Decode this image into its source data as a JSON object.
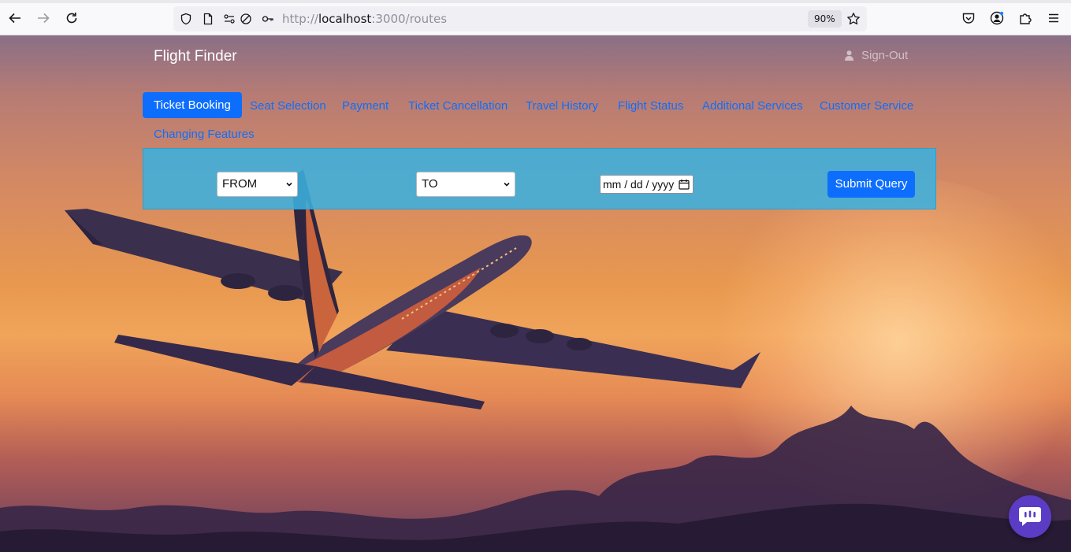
{
  "browser": {
    "url_scheme": "http://",
    "url_host": "localhost",
    "url_path": ":3000/routes",
    "zoom": "90%"
  },
  "header": {
    "brand": "Flight Finder",
    "signout_label": "Sign-Out"
  },
  "nav": {
    "items": [
      {
        "label": "Ticket Booking",
        "active": true
      },
      {
        "label": "Seat Selection"
      },
      {
        "label": "Payment"
      },
      {
        "label": "Ticket Cancellation"
      },
      {
        "label": "Travel History"
      },
      {
        "label": "Flight Status"
      },
      {
        "label": "Additional Services"
      },
      {
        "label": "Customer Service"
      },
      {
        "label": "Changing Features"
      }
    ]
  },
  "search": {
    "from_value": "FROM",
    "to_value": "TO",
    "date_placeholder": "mm / dd / yyyy",
    "submit_label": "Submit Query"
  },
  "colors": {
    "primary": "#0d6efd",
    "panel": "#3cb0de",
    "chat": "#5b3cc4"
  }
}
